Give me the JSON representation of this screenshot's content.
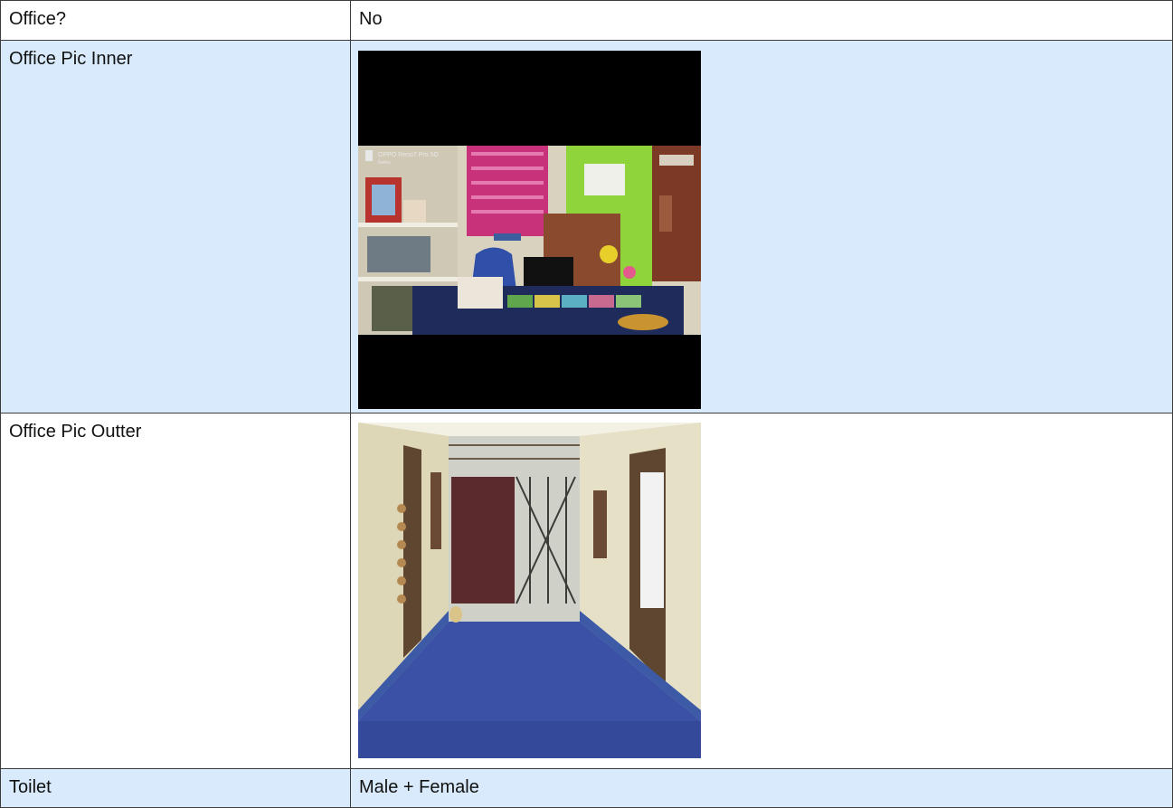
{
  "rows": [
    {
      "label": "Office?",
      "value": "No"
    },
    {
      "label": "Office Pic Inner",
      "image": "office-inner-photo"
    },
    {
      "label": "Office Pic Outter",
      "image": "office-outer-photo"
    },
    {
      "label": "Toilet",
      "value": "Male + Female"
    }
  ],
  "photos": {
    "inner_watermark": "OPPO Reno7 Pro 5G",
    "inner_watermark_sub": "Nehru"
  },
  "colors": {
    "alt_row": "#d8eafb",
    "border": "#3c3c3c"
  }
}
